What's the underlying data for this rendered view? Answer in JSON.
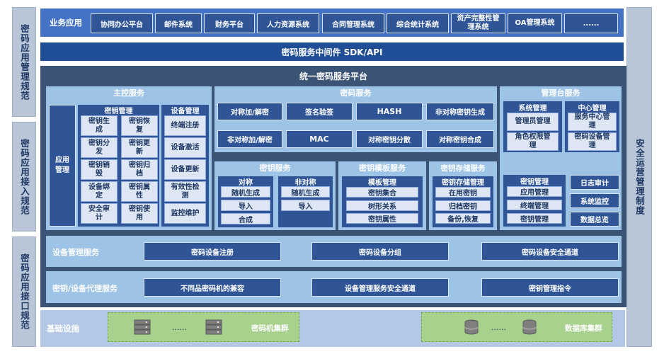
{
  "left_sidebar": {
    "management_spec": "密码应用管理规范",
    "access_spec": "密码应用接入规范",
    "interface_spec": "密码应用接口规范"
  },
  "right_sidebar": {
    "label": "安全运营管理制度"
  },
  "business": {
    "label": "业务应用",
    "apps": [
      "协同办公平台",
      "邮件系统",
      "财务平台",
      "人力资源系统",
      "合同管理系统",
      "综合统计系统",
      "资产完整性管理系统",
      "OA管理系统",
      "......"
    ]
  },
  "sdk_bar": "密码服务中间件 SDK/API",
  "platform_title": "统一密码服务平台",
  "master": {
    "title": "主控服务",
    "app_mgmt": "应用管理",
    "key_mgmt_title": "密钥管理",
    "key_items": [
      "密钥生成",
      "密钥恢复",
      "密钥分发",
      "密钥更新",
      "密钥销毁",
      "密钥归档",
      "设备绑定",
      "密钥属性",
      "安全审计",
      "密钥使用"
    ],
    "device_mgmt_title": "设备管理",
    "device_items": [
      "终端注册",
      "设备激活",
      "设备更新",
      "有效性检测",
      "监控维护"
    ]
  },
  "crypto": {
    "title": "密码服务",
    "row1": [
      "对称加/解密",
      "签名验签",
      "HASH",
      "非对称密钥生成"
    ],
    "row2": [
      "非对称加/解密",
      "MAC",
      "对称密钥分散",
      "对称密钥合成"
    ]
  },
  "key_service": {
    "title": "密钥服务",
    "sym_title": "对称",
    "sym_items": [
      "随机生成",
      "导入",
      "合成"
    ],
    "asym_title": "非对称",
    "asym_items": [
      "随机生成",
      "导入"
    ]
  },
  "template_service": {
    "title": "密钥模板服务",
    "inner_title": "模板管理",
    "items": [
      "密钥集合",
      "树形关系",
      "密钥属性"
    ]
  },
  "storage_service": {
    "title": "密钥存储服务",
    "inner_title": "密钥存储管理",
    "items": [
      "在用密钥",
      "归档密钥",
      "备份,恢复"
    ]
  },
  "admin": {
    "title": "管理台服务",
    "sys_title": "系统管理",
    "sys_items": [
      "管理员管理",
      "角色权限管理"
    ],
    "center_title": "中心管理",
    "center_items": [
      "服务中心管理",
      "密码设备管理"
    ],
    "key_title": "密钥管理",
    "key_items": [
      "应用管理",
      "终端管理",
      "密钥管理"
    ],
    "right_items": [
      "日志审计",
      "系统监控",
      "数据总览"
    ]
  },
  "device_service": {
    "label": "设备管理服务",
    "items": [
      "密码设备注册",
      "密码设备分组",
      "密码设备安全通道"
    ]
  },
  "proxy_service": {
    "label": "密钥/设备代理服务",
    "items": [
      "不同品密码机的兼容",
      "设备管理服务安全通道",
      "密钥管理指令"
    ]
  },
  "infra": {
    "label": "基础设施",
    "hsm_label": "密码机集群",
    "db_label": "数据库集群",
    "ellipsis": "......"
  }
}
